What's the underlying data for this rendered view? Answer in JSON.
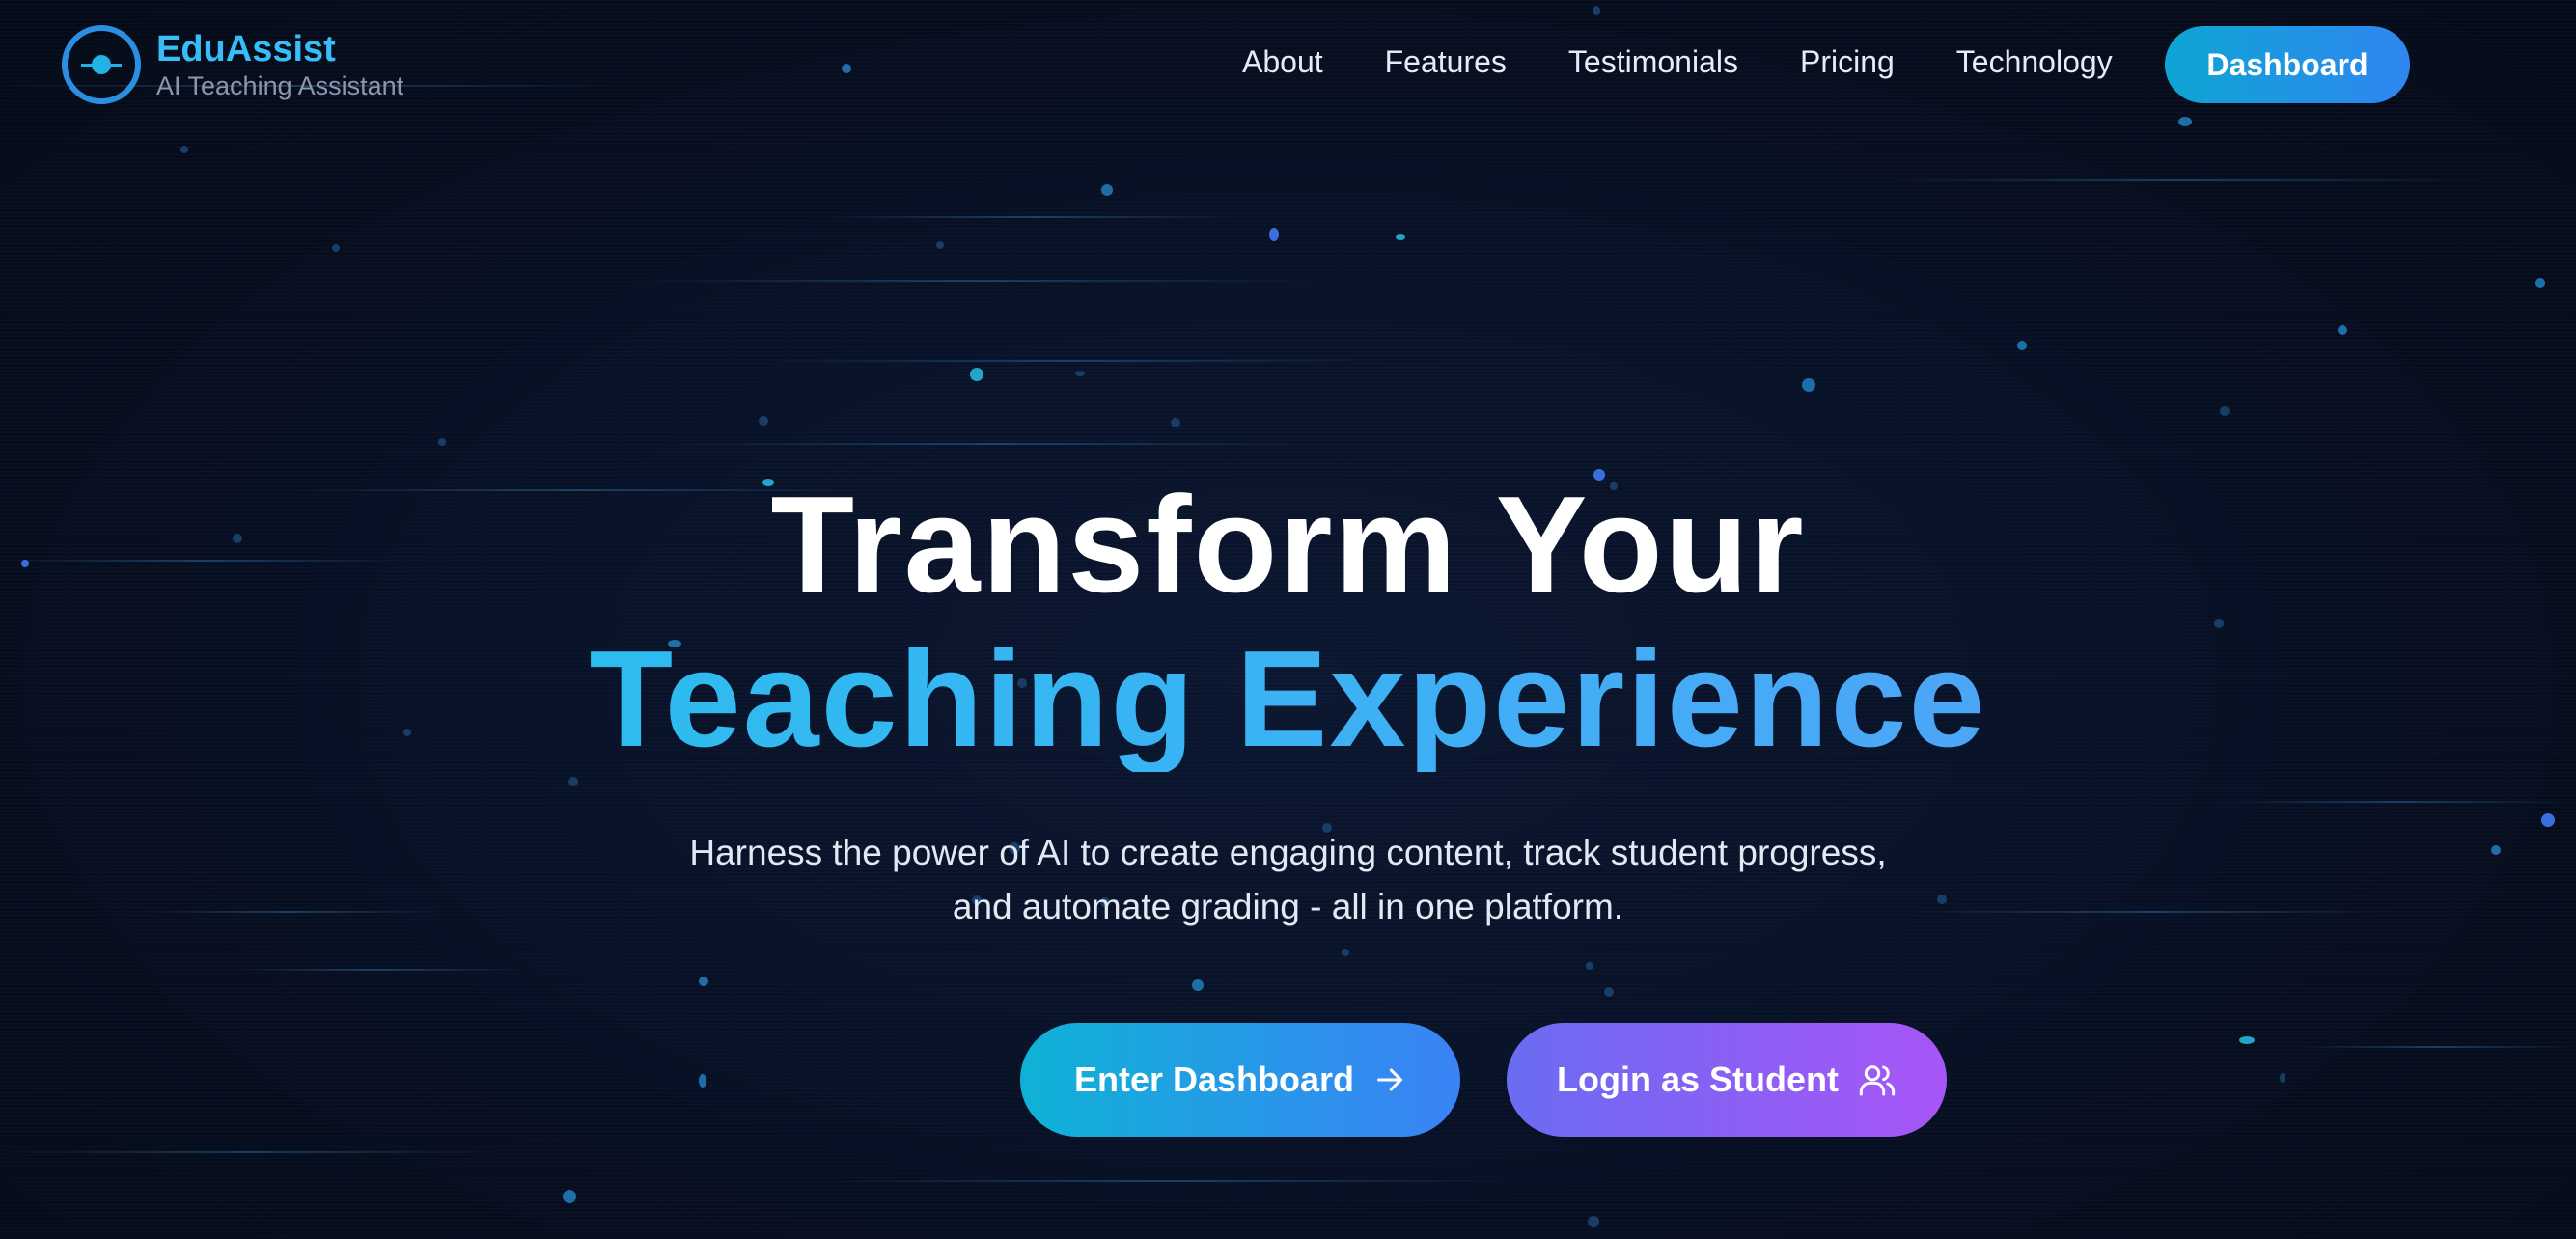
{
  "brand": {
    "name": "EduAssist",
    "tagline": "AI Teaching Assistant"
  },
  "nav": {
    "items": [
      {
        "label": "About"
      },
      {
        "label": "Features"
      },
      {
        "label": "Testimonials"
      },
      {
        "label": "Pricing"
      },
      {
        "label": "Technology"
      }
    ],
    "dashboard_label": "Dashboard"
  },
  "hero": {
    "title_line1": "Transform Your",
    "title_line2": "Teaching Experience",
    "subtitle_line1": "Harness the power of AI to create engaging content, track student progress,",
    "subtitle_line2": "and automate grading - all in one platform.",
    "primary_cta": {
      "label": "Enter Dashboard",
      "icon": "arrow-right-icon"
    },
    "secondary_cta": {
      "label": "Login as Student",
      "icon": "users-icon"
    }
  },
  "colors": {
    "background": "#060d1d",
    "accent_cyan": "#38bdf8",
    "accent_blue": "#3b82f6",
    "accent_purple": "#a855f7"
  }
}
